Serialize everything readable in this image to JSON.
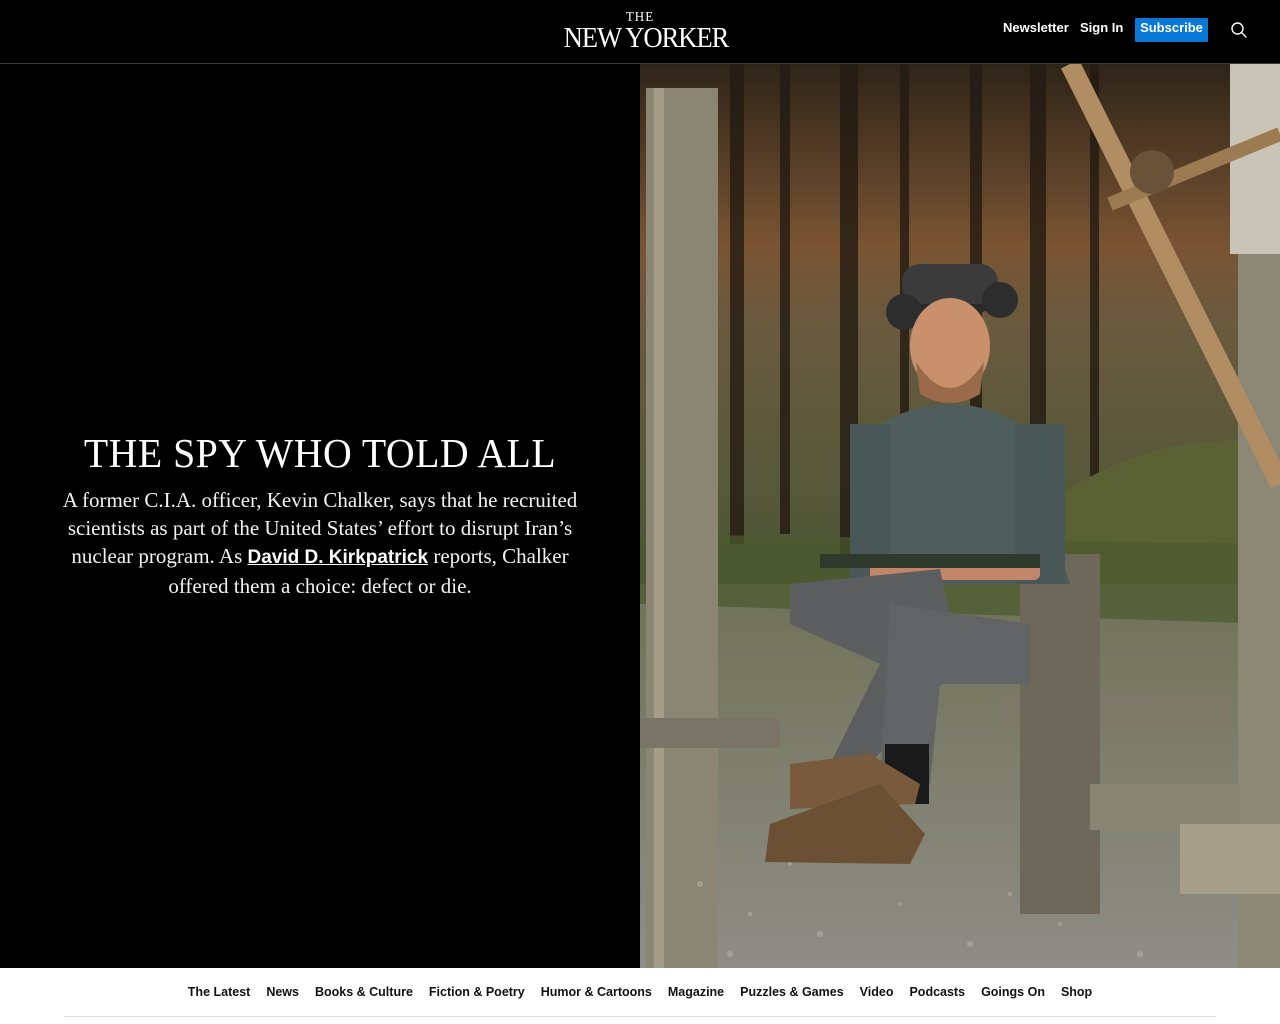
{
  "header": {
    "logo_top": "THE",
    "logo_main": "NEW YORKER",
    "newsletter_label": "Newsletter",
    "signin_label": "Sign In",
    "subscribe_label": "Subscribe",
    "search_icon": "search-icon",
    "accent_color": "#0a78d6"
  },
  "hero": {
    "title": "THE SPY WHO TOLD ALL",
    "dek_before": "A former C.I.A. officer, Kevin Chalker, says that he recruited scientists as part of the United States’ effort to disrupt Iran’s nuclear program. As ",
    "author": "David D. Kirkpatrick",
    "dek_after": " reports, Chalker offered them a choice: defect or die."
  },
  "nav": {
    "items": [
      {
        "label": "The Latest"
      },
      {
        "label": "News"
      },
      {
        "label": "Books & Culture"
      },
      {
        "label": "Fiction & Poetry"
      },
      {
        "label": "Humor & Cartoons"
      },
      {
        "label": "Magazine"
      },
      {
        "label": "Puzzles & Games"
      },
      {
        "label": "Video"
      },
      {
        "label": "Podcasts"
      },
      {
        "label": "Goings On"
      },
      {
        "label": "Shop"
      }
    ]
  }
}
